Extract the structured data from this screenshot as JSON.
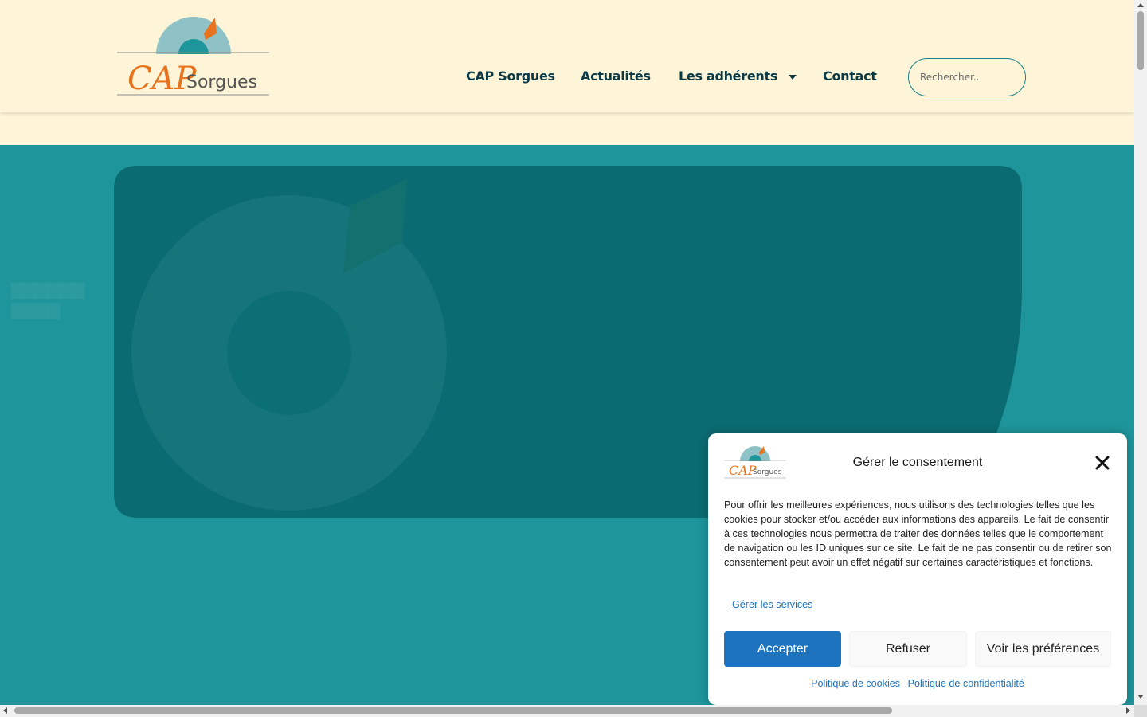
{
  "brand": {
    "logo_text_main": "CAP",
    "logo_text_sub": "Sorgues",
    "colors": {
      "teal": "#1e959b",
      "dark_teal": "#0b6b72",
      "orange": "#e8731e",
      "cream": "#fef5d9",
      "nav_text": "#0d3b45",
      "link_blue": "#1e73be"
    }
  },
  "nav": {
    "items": [
      {
        "label": "CAP Sorgues"
      },
      {
        "label": "Actualités"
      },
      {
        "label": "Les adhérents",
        "has_dropdown": true
      },
      {
        "label": "Contact"
      }
    ],
    "search_placeholder": "Rechercher..."
  },
  "consent": {
    "title": "Gérer le consentement",
    "close_icon": "close-icon",
    "body": "Pour offrir les meilleures expériences, nous utilisons des technologies telles que les cookies pour stocker et/ou accéder aux informations des appareils. Le fait de consentir à ces technologies nous permettra de traiter des données telles que le comportement de navigation ou les ID uniques sur ce site. Le fait de ne pas consentir ou de retirer son consentement peut avoir un effet négatif sur certaines caractéristiques et fonctions.",
    "manage_services": "Gérer les services",
    "buttons": {
      "accept": "Accepter",
      "refuse": "Refuser",
      "preferences": "Voir les préférences"
    },
    "links": {
      "cookie_policy": "Politique de cookies",
      "privacy_policy": "Politique de confidentialité"
    }
  }
}
